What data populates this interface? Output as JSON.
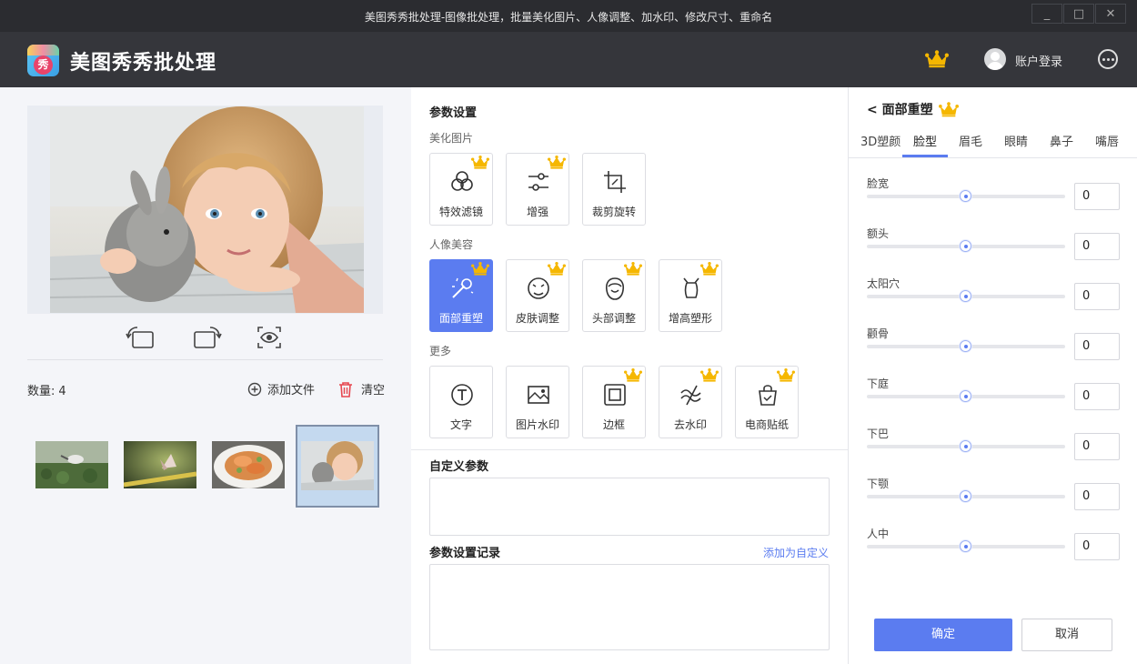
{
  "window": {
    "title": "美图秀秀批处理-图像批处理，批量美化图片、人像调整、加水印、修改尺寸、重命名",
    "minimize": "_",
    "maximize": "□",
    "close": "✕"
  },
  "header": {
    "app_name": "美图秀秀批处理",
    "logo_glyph": "秀",
    "login_label": "账户登录"
  },
  "left": {
    "count_label": "数量:",
    "count_value": "4",
    "add_file_label": "添加文件",
    "clear_label": "清空"
  },
  "params": {
    "title": "参数设置",
    "groups": [
      {
        "label": "美化图片",
        "items": [
          {
            "label": "特效滤镜",
            "icon": "filter-icon",
            "vip": true
          },
          {
            "label": "增强",
            "icon": "sliders-icon",
            "vip": true
          },
          {
            "label": "裁剪旋转",
            "icon": "crop-icon",
            "vip": false
          }
        ]
      },
      {
        "label": "人像美容",
        "items": [
          {
            "label": "面部重塑",
            "icon": "magic-wand-icon",
            "vip": true,
            "active": true
          },
          {
            "label": "皮肤调整",
            "icon": "skin-icon",
            "vip": true
          },
          {
            "label": "头部调整",
            "icon": "head-icon",
            "vip": true
          },
          {
            "label": "增高塑形",
            "icon": "body-shape-icon",
            "vip": true
          }
        ]
      },
      {
        "label": "更多",
        "items": [
          {
            "label": "文字",
            "icon": "text-icon",
            "vip": false
          },
          {
            "label": "图片水印",
            "icon": "image-watermark-icon",
            "vip": false
          },
          {
            "label": "边框",
            "icon": "frame-icon",
            "vip": true
          },
          {
            "label": "去水印",
            "icon": "remove-watermark-icon",
            "vip": true
          },
          {
            "label": "电商贴纸",
            "icon": "sticker-bag-icon",
            "vip": true
          }
        ]
      }
    ],
    "custom_title": "自定义参数",
    "record_title": "参数设置记录",
    "add_custom_link": "添加为自定义"
  },
  "face": {
    "back_title": "< 面部重塑",
    "tabs": [
      "3D塑颜",
      "脸型",
      "眉毛",
      "眼睛",
      "鼻子",
      "嘴唇"
    ],
    "active_tab": "脸型",
    "params": [
      {
        "label": "脸宽",
        "value": "0"
      },
      {
        "label": "额头",
        "value": "0"
      },
      {
        "label": "太阳穴",
        "value": "0"
      },
      {
        "label": "颧骨",
        "value": "0"
      },
      {
        "label": "下庭",
        "value": "0"
      },
      {
        "label": "下巴",
        "value": "0"
      },
      {
        "label": "下颚",
        "value": "0"
      },
      {
        "label": "人中",
        "value": "0"
      }
    ],
    "confirm_label": "确定",
    "cancel_label": "取消"
  },
  "colors": {
    "accent": "#5b7cf0",
    "crown": "#f5b700",
    "titlebar": "#2b2c30",
    "header": "#35363b",
    "clear_red": "#e6464f"
  }
}
